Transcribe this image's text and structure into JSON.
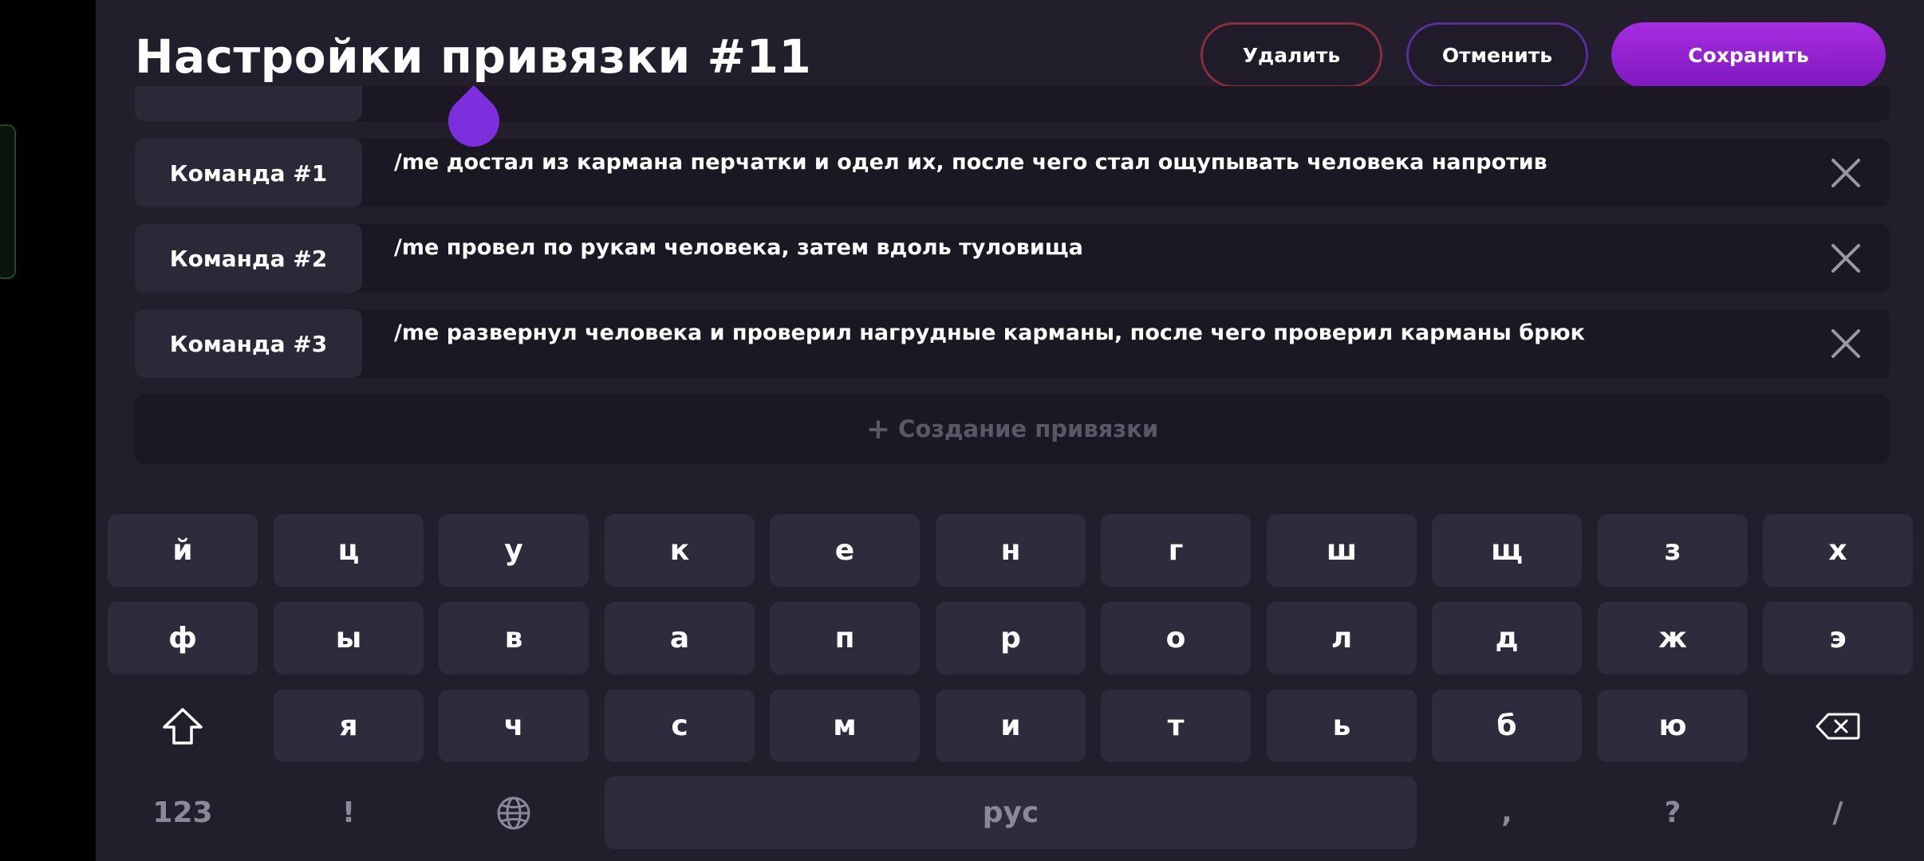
{
  "header": {
    "title": "Настройки привязки #11",
    "delete_label": "Удалить",
    "cancel_label": "Отменить",
    "save_label": "Сохранить"
  },
  "commands": [
    {
      "label": "Команда #1",
      "text": "/me достал из кармана перчатки и одел их, после чего стал ощупывать человека напротив"
    },
    {
      "label": "Команда #2",
      "text": "/me провел по рукам человека, затем вдоль туловища"
    },
    {
      "label": "Команда #3",
      "text": "/me развернул человека и проверил нагрудные карманы, после чего проверил карманы брюк"
    }
  ],
  "create_label": "Создание привязки",
  "keyboard": {
    "row1": [
      "й",
      "ц",
      "у",
      "к",
      "е",
      "н",
      "г",
      "ш",
      "щ",
      "з",
      "х"
    ],
    "row2": [
      "ф",
      "ы",
      "в",
      "а",
      "п",
      "р",
      "о",
      "л",
      "д",
      "ж",
      "э"
    ],
    "row3": [
      "я",
      "ч",
      "с",
      "м",
      "и",
      "т",
      "ь",
      "б",
      "ю"
    ],
    "numbers_label": "123",
    "exclaim_label": "!",
    "space_label": "рус",
    "comma_label": ",",
    "question_label": "?",
    "slash_label": "/"
  },
  "colors": {
    "background": "#221e2c",
    "accent": "#9b24d8",
    "delete_border": "#8a2e3a",
    "cancel_border": "#5a2f9a"
  }
}
